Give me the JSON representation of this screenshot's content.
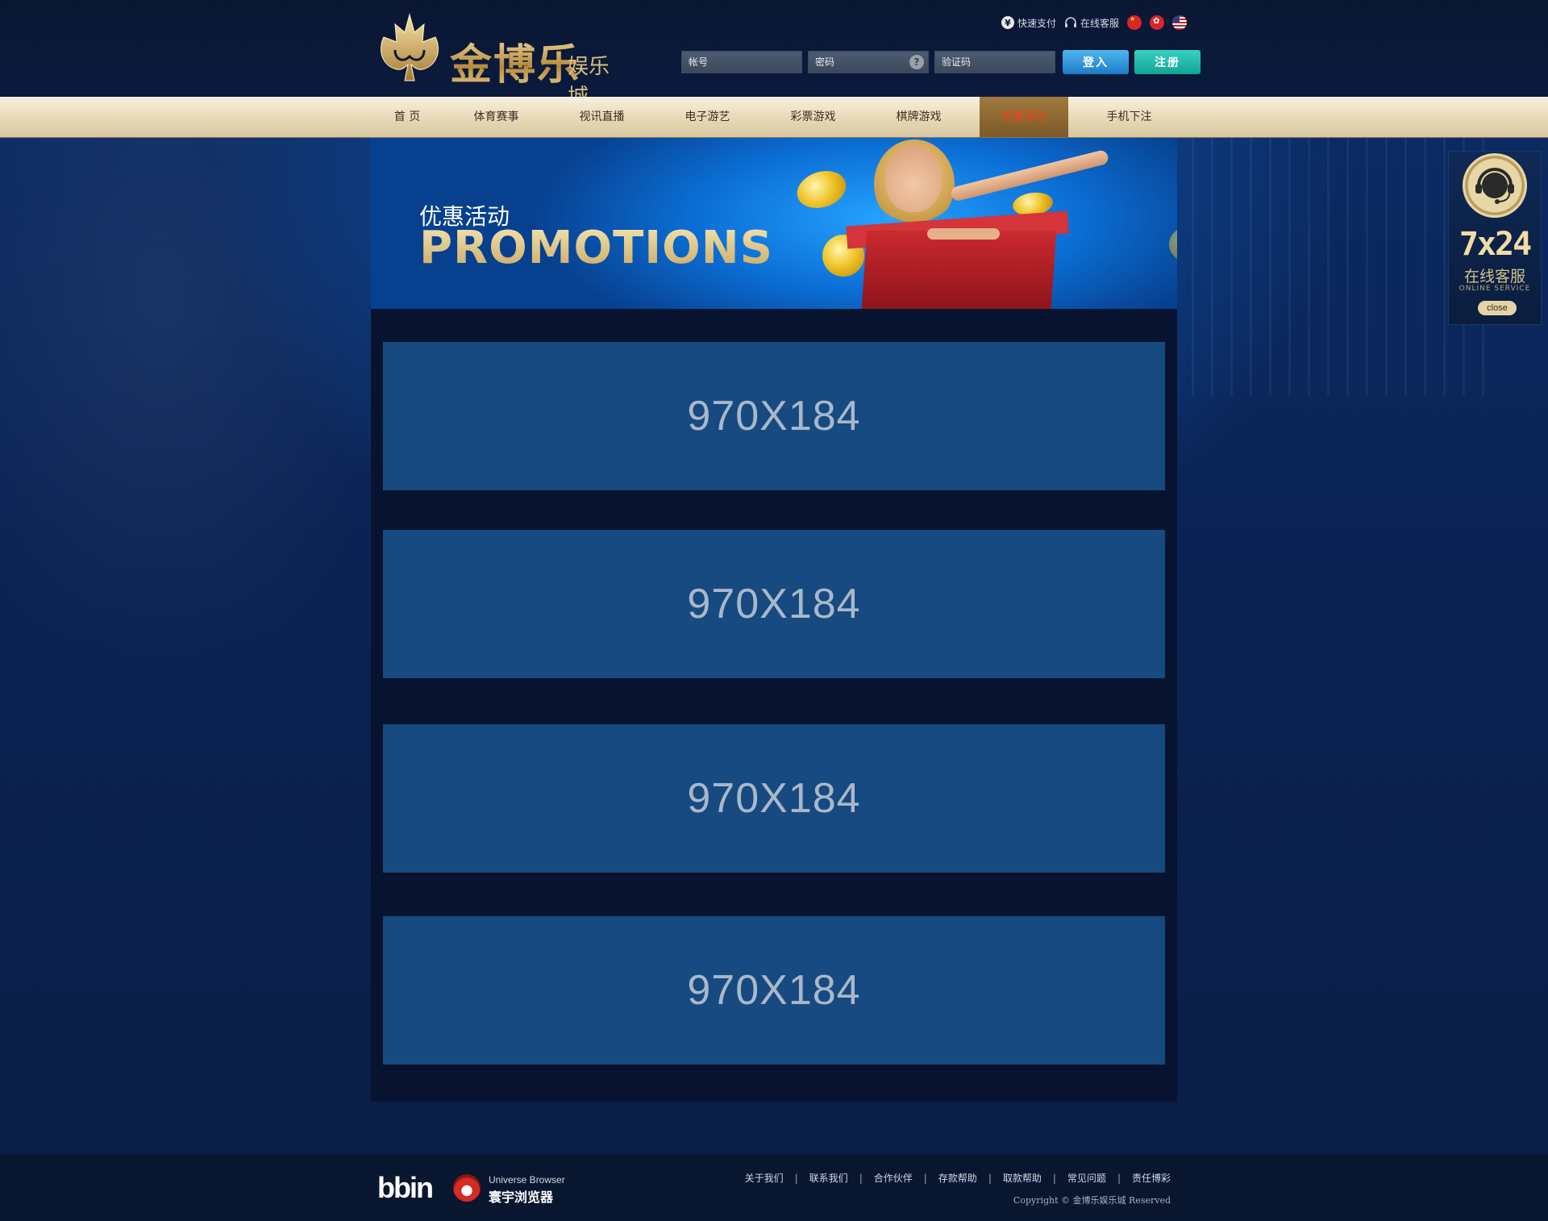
{
  "brand": {
    "name": "金博乐",
    "sub": "娱乐城"
  },
  "toplinks": {
    "pay": "快速支付",
    "service": "在线客服",
    "yen_glyph": "¥",
    "flags": [
      "flag-cn-icon",
      "flag-hk-icon",
      "flag-us-icon"
    ]
  },
  "login": {
    "account_placeholder": "帐号",
    "password_placeholder": "密码",
    "captcha_placeholder": "验证码",
    "help_glyph": "?",
    "login_label": "登入",
    "register_label": "注册"
  },
  "nav": {
    "items": [
      "首 页",
      "体育赛事",
      "视讯直播",
      "电子游艺",
      "彩票游戏",
      "棋牌游戏",
      "优惠活动",
      "手机下注"
    ],
    "active_index": 6
  },
  "banner": {
    "cn": "优惠活动",
    "en": "PROMOTIONS"
  },
  "promos": [
    "970X184",
    "970X184",
    "970X184",
    "970X184"
  ],
  "service": {
    "title": "7x24",
    "cn": "在线客服",
    "en": "ONLINE SERVICE",
    "close": "close"
  },
  "footer": {
    "bbin": "bbin",
    "browser_en": "Universe Browser",
    "browser_cn": "寰宇浏览器",
    "links": [
      "关于我们",
      "联系我们",
      "合作伙伴",
      "存款帮助",
      "取款帮助",
      "常见问题",
      "责任博彩"
    ],
    "separator": "|",
    "copyright": "Copyright © 金博乐娱乐城 Reserved"
  },
  "colors": {
    "accent_gold": "#d9bf7c",
    "nav_active": "#ff3b1f",
    "login_btn": "#1d7cc8",
    "register_btn": "#12a394",
    "promo_bg": "#164a80"
  }
}
